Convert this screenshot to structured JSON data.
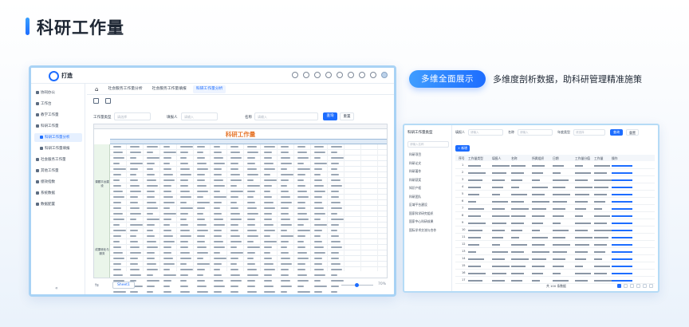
{
  "page": {
    "title": "科研工作量"
  },
  "feature": {
    "badge": "多维全面展示",
    "tagline": "多维度剖析数据，助科研管理精准施策"
  },
  "app": {
    "logo_text": "打造",
    "sidebar": [
      {
        "label": "协同办公",
        "level": 0,
        "active": false
      },
      {
        "label": "工作台",
        "level": 0,
        "active": false
      },
      {
        "label": "教学工作量",
        "level": 0,
        "active": false
      },
      {
        "label": "科研工作量",
        "level": 0,
        "active": false
      },
      {
        "label": "科研工作量分析",
        "level": 1,
        "active": true
      },
      {
        "label": "科研工作量填报",
        "level": 1,
        "active": false
      },
      {
        "label": "社会服务工作量",
        "level": 0,
        "active": false
      },
      {
        "label": "其他工作量",
        "level": 0,
        "active": false
      },
      {
        "label": "绩效指数",
        "level": 0,
        "active": false
      },
      {
        "label": "系统数据",
        "level": 0,
        "active": false
      },
      {
        "label": "数据配置",
        "level": 0,
        "active": false
      }
    ],
    "tabs": [
      {
        "label": "社会服务工作量分析",
        "active": false
      },
      {
        "label": "社会服务工作量填报",
        "active": false
      },
      {
        "label": "科研工作量分析",
        "active": true
      }
    ],
    "filters": {
      "type_label": "工作量类型",
      "type_placeholder": "请选择",
      "filler_label": "填报人",
      "filler_placeholder": "请输入",
      "name_label": "名称",
      "name_placeholder": "请输入",
      "query_button": "查询",
      "reset_button": "重置"
    },
    "sheet": {
      "title": "科研工作量",
      "side_groups": [
        "课题平台建设",
        "成果转化与服务"
      ],
      "sheet_tab": "Sheet1",
      "zoom": "70%"
    }
  },
  "detail": {
    "sidebar_title": "科研工作量类型",
    "search_placeholder": "请输入名称",
    "nav": [
      "科研项目",
      "科研论文",
      "科研著作",
      "科研获奖",
      "知识产权",
      "科研团队",
      "区域平台建设",
      "国家科学研究组织",
      "国家中心科研成果",
      "国际学术交流与合作"
    ],
    "filters": {
      "filler_label": "填报人",
      "filler_placeholder": "请输入",
      "name_label": "名称",
      "name_placeholder": "请输入",
      "type_label": "年度类型",
      "type_placeholder": "请选择",
      "query_button": "查询",
      "reset_button": "重置"
    },
    "add_button": "+ 新增",
    "columns": [
      "序号",
      "工作量类型",
      "填报人",
      "名称",
      "所属组织",
      "日期",
      "工作量分值",
      "工作量",
      "操作"
    ],
    "row_numbers": [
      "1",
      "2",
      "3",
      "4",
      "5",
      "6",
      "7",
      "8",
      "9",
      "10",
      "11",
      "12",
      "13",
      "14",
      "15",
      "16",
      "17",
      "18",
      "19",
      "20",
      "21",
      "22"
    ],
    "pager_text": "共 100 条数据"
  }
}
